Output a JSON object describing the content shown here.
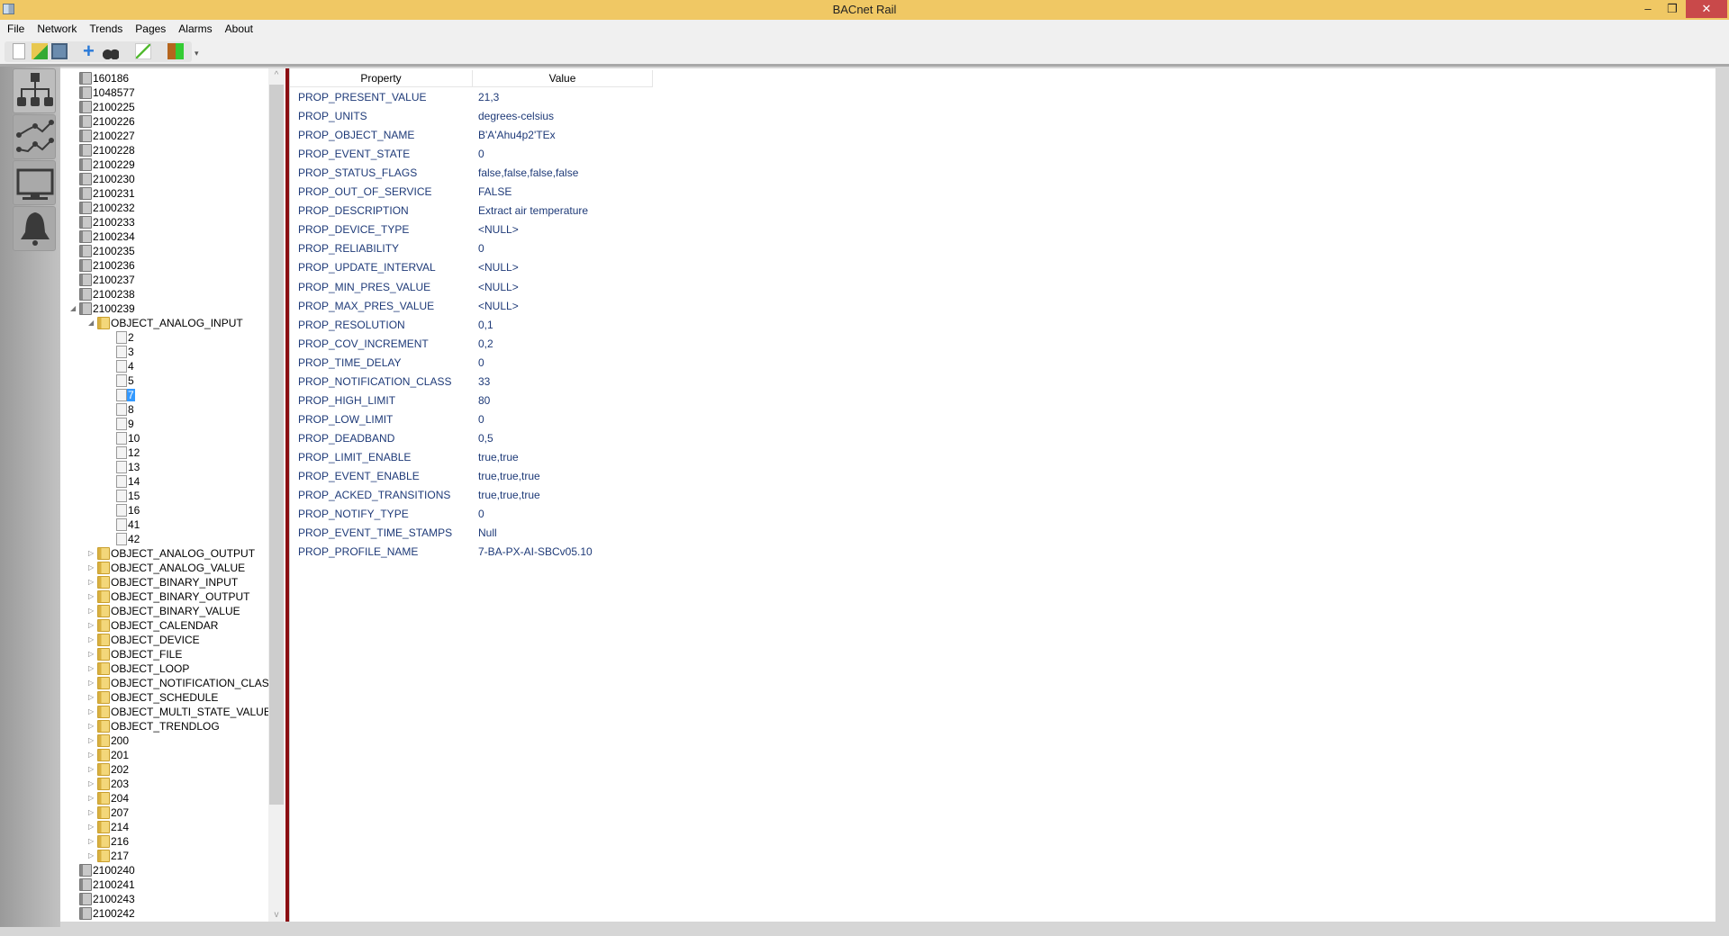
{
  "window": {
    "title": "BACnet Rail",
    "minimize": "–",
    "restore": "❐",
    "close": "✕"
  },
  "menu": [
    "File",
    "Network",
    "Trends",
    "Pages",
    "Alarms",
    "About"
  ],
  "toolbar": [
    "new-file",
    "open-folder",
    "save",
    "add",
    "find",
    "edit",
    "exit"
  ],
  "rail": [
    "network-tree",
    "trends",
    "pages-monitor",
    "alarms-bell"
  ],
  "tree": [
    {
      "label": "160186",
      "type": "dev",
      "level": 0
    },
    {
      "label": "1048577",
      "type": "dev",
      "level": 0
    },
    {
      "label": "2100225",
      "type": "dev",
      "level": 0
    },
    {
      "label": "2100226",
      "type": "dev",
      "level": 0
    },
    {
      "label": "2100227",
      "type": "dev",
      "level": 0
    },
    {
      "label": "2100228",
      "type": "dev",
      "level": 0
    },
    {
      "label": "2100229",
      "type": "dev",
      "level": 0
    },
    {
      "label": "2100230",
      "type": "dev",
      "level": 0
    },
    {
      "label": "2100231",
      "type": "dev",
      "level": 0
    },
    {
      "label": "2100232",
      "type": "dev",
      "level": 0
    },
    {
      "label": "2100233",
      "type": "dev",
      "level": 0
    },
    {
      "label": "2100234",
      "type": "dev",
      "level": 0
    },
    {
      "label": "2100235",
      "type": "dev",
      "level": 0
    },
    {
      "label": "2100236",
      "type": "dev",
      "level": 0
    },
    {
      "label": "2100237",
      "type": "dev",
      "level": 0
    },
    {
      "label": "2100238",
      "type": "dev",
      "level": 0
    },
    {
      "label": "2100239",
      "type": "dev",
      "level": 0,
      "expanded": true
    },
    {
      "label": "OBJECT_ANALOG_INPUT",
      "type": "fold",
      "level": 1,
      "expanded": true
    },
    {
      "label": "2",
      "type": "leaf",
      "level": 2
    },
    {
      "label": "3",
      "type": "leaf",
      "level": 2
    },
    {
      "label": "4",
      "type": "leaf",
      "level": 2
    },
    {
      "label": "5",
      "type": "leaf",
      "level": 2
    },
    {
      "label": "7",
      "type": "leaf",
      "level": 2,
      "selected": true
    },
    {
      "label": "8",
      "type": "leaf",
      "level": 2
    },
    {
      "label": "9",
      "type": "leaf",
      "level": 2
    },
    {
      "label": "10",
      "type": "leaf",
      "level": 2
    },
    {
      "label": "12",
      "type": "leaf",
      "level": 2
    },
    {
      "label": "13",
      "type": "leaf",
      "level": 2
    },
    {
      "label": "14",
      "type": "leaf",
      "level": 2
    },
    {
      "label": "15",
      "type": "leaf",
      "level": 2
    },
    {
      "label": "16",
      "type": "leaf",
      "level": 2
    },
    {
      "label": "41",
      "type": "leaf",
      "level": 2
    },
    {
      "label": "42",
      "type": "leaf",
      "level": 2
    },
    {
      "label": "OBJECT_ANALOG_OUTPUT",
      "type": "fold",
      "level": 1
    },
    {
      "label": "OBJECT_ANALOG_VALUE",
      "type": "fold",
      "level": 1
    },
    {
      "label": "OBJECT_BINARY_INPUT",
      "type": "fold",
      "level": 1
    },
    {
      "label": "OBJECT_BINARY_OUTPUT",
      "type": "fold",
      "level": 1
    },
    {
      "label": "OBJECT_BINARY_VALUE",
      "type": "fold",
      "level": 1
    },
    {
      "label": "OBJECT_CALENDAR",
      "type": "fold",
      "level": 1
    },
    {
      "label": "OBJECT_DEVICE",
      "type": "fold",
      "level": 1
    },
    {
      "label": "OBJECT_FILE",
      "type": "fold",
      "level": 1
    },
    {
      "label": "OBJECT_LOOP",
      "type": "fold",
      "level": 1
    },
    {
      "label": "OBJECT_NOTIFICATION_CLASS",
      "type": "fold",
      "level": 1
    },
    {
      "label": "OBJECT_SCHEDULE",
      "type": "fold",
      "level": 1
    },
    {
      "label": "OBJECT_MULTI_STATE_VALUE",
      "type": "fold",
      "level": 1
    },
    {
      "label": "OBJECT_TRENDLOG",
      "type": "fold",
      "level": 1
    },
    {
      "label": "200",
      "type": "fold",
      "level": 1
    },
    {
      "label": "201",
      "type": "fold",
      "level": 1
    },
    {
      "label": "202",
      "type": "fold",
      "level": 1
    },
    {
      "label": "203",
      "type": "fold",
      "level": 1
    },
    {
      "label": "204",
      "type": "fold",
      "level": 1
    },
    {
      "label": "207",
      "type": "fold",
      "level": 1
    },
    {
      "label": "214",
      "type": "fold",
      "level": 1
    },
    {
      "label": "216",
      "type": "fold",
      "level": 1
    },
    {
      "label": "217",
      "type": "fold",
      "level": 1
    },
    {
      "label": "2100240",
      "type": "dev",
      "level": 0
    },
    {
      "label": "2100241",
      "type": "dev",
      "level": 0
    },
    {
      "label": "2100243",
      "type": "dev",
      "level": 0
    },
    {
      "label": "2100242",
      "type": "dev",
      "level": 0
    }
  ],
  "properties": {
    "headers": {
      "property": "Property",
      "value": "Value"
    },
    "rows": [
      [
        "PROP_PRESENT_VALUE",
        "21,3"
      ],
      [
        "PROP_UNITS",
        "degrees-celsius"
      ],
      [
        "PROP_OBJECT_NAME",
        "B'A'Ahu4p2'TEx"
      ],
      [
        "PROP_EVENT_STATE",
        "0"
      ],
      [
        "PROP_STATUS_FLAGS",
        "false,false,false,false"
      ],
      [
        "PROP_OUT_OF_SERVICE",
        "FALSE"
      ],
      [
        "PROP_DESCRIPTION",
        "Extract air temperature"
      ],
      [
        "PROP_DEVICE_TYPE",
        "<NULL>"
      ],
      [
        "PROP_RELIABILITY",
        "0"
      ],
      [
        "PROP_UPDATE_INTERVAL",
        "<NULL>"
      ],
      [
        "PROP_MIN_PRES_VALUE",
        "<NULL>"
      ],
      [
        "PROP_MAX_PRES_VALUE",
        "<NULL>"
      ],
      [
        "PROP_RESOLUTION",
        "0,1"
      ],
      [
        "PROP_COV_INCREMENT",
        "0,2"
      ],
      [
        "PROP_TIME_DELAY",
        "0"
      ],
      [
        "PROP_NOTIFICATION_CLASS",
        "33"
      ],
      [
        "PROP_HIGH_LIMIT",
        "80"
      ],
      [
        "PROP_LOW_LIMIT",
        "0"
      ],
      [
        "PROP_DEADBAND",
        "0,5"
      ],
      [
        "PROP_LIMIT_ENABLE",
        "true,true"
      ],
      [
        "PROP_EVENT_ENABLE",
        "true,true,true"
      ],
      [
        "PROP_ACKED_TRANSITIONS",
        "true,true,true"
      ],
      [
        "PROP_NOTIFY_TYPE",
        "0"
      ],
      [
        "PROP_EVENT_TIME_STAMPS",
        "Null"
      ],
      [
        "PROP_PROFILE_NAME",
        "7-BA-PX-AI-SBCv05.10"
      ]
    ]
  }
}
